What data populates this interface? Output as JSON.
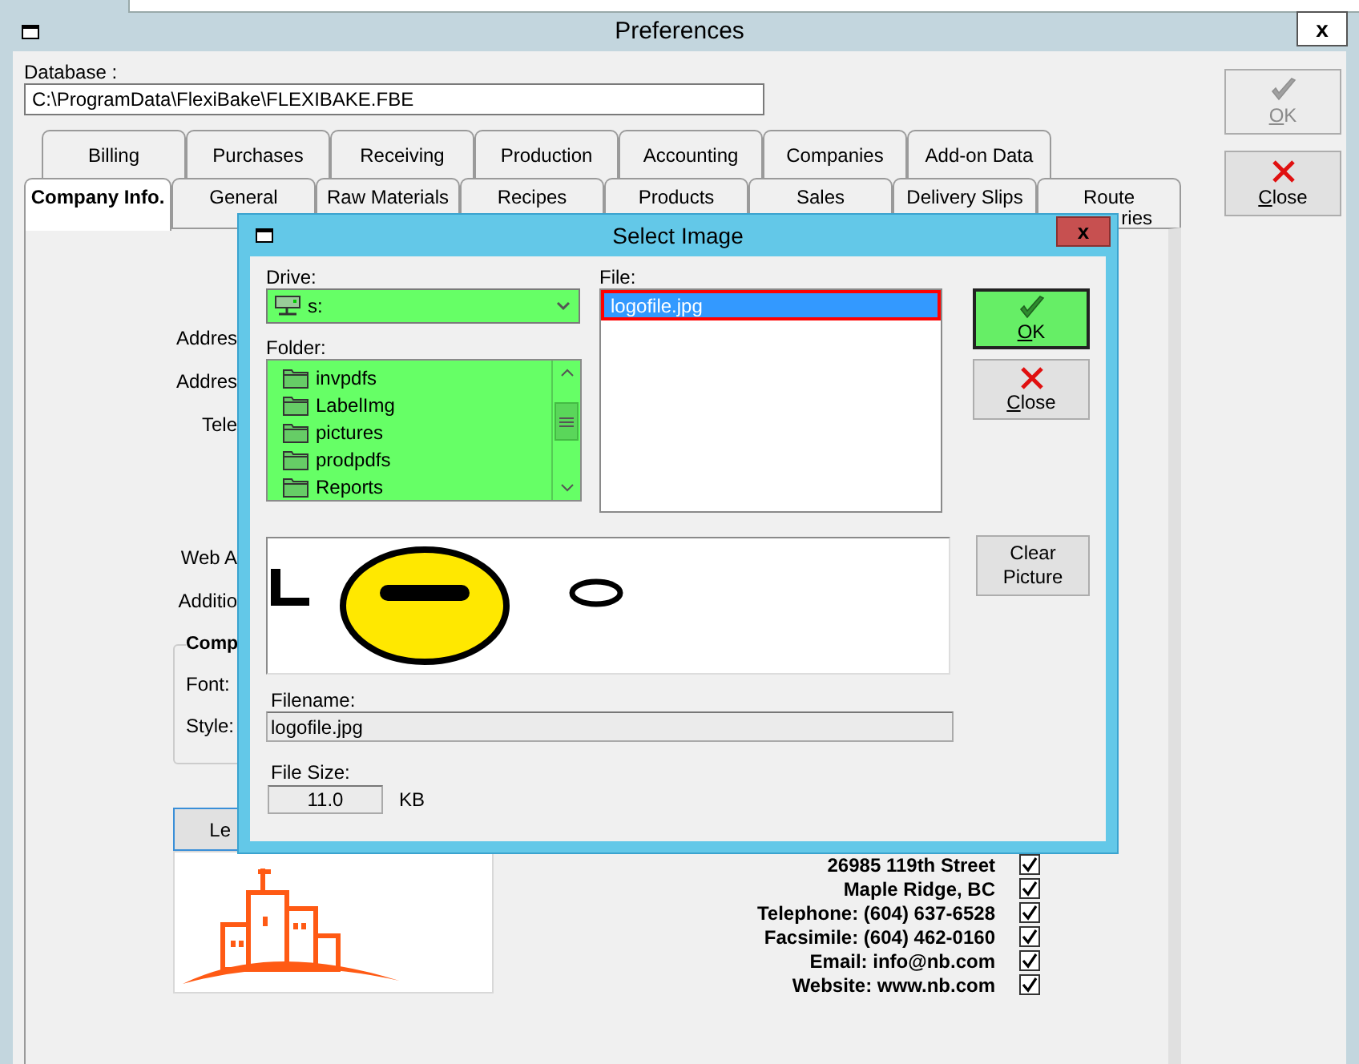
{
  "window": {
    "title": "Preferences",
    "close": "x"
  },
  "database": {
    "label": "Database :",
    "value": "C:\\ProgramData\\FlexiBake\\FLEXIBAKE.FBE"
  },
  "buttons": [
    {
      "label": "OK",
      "disabled": true,
      "kind": "ok"
    },
    {
      "label": "Close",
      "disabled": false,
      "kind": "close"
    }
  ],
  "tabs_row_1": [
    {
      "label": "Billing",
      "selected": false
    },
    {
      "label": "Purchases",
      "selected": false
    },
    {
      "label": "Receiving",
      "selected": false
    },
    {
      "label": "Production",
      "selected": false
    },
    {
      "label": "Accounting",
      "selected": false
    },
    {
      "label": "Companies",
      "selected": false
    },
    {
      "label": "Add-on Data",
      "selected": false
    }
  ],
  "tabs_row_2": [
    {
      "label": "Company Info.",
      "selected": true
    },
    {
      "label": "General",
      "selected": false
    },
    {
      "label": "Raw Materials",
      "selected": false
    },
    {
      "label": "Recipes",
      "selected": false
    },
    {
      "label": "Products",
      "selected": false
    },
    {
      "label": "Sales",
      "selected": false
    },
    {
      "label": "Delivery Slips",
      "selected": false
    },
    {
      "label": "Route",
      "label_2": "ries",
      "selected": false
    }
  ],
  "company_info": {
    "labels": [
      "Addres",
      "Addres",
      "Tele",
      "Web A",
      "Additio"
    ],
    "group": {
      "title": "Comp",
      "labels": [
        "Font:",
        "Style:"
      ]
    },
    "logo_button": {
      "label": "Le",
      "focused": true
    },
    "logo": {
      "kind": "picture"
    },
    "header_lines": [
      {
        "text": "26985 119th Street",
        "checked": true
      },
      {
        "text": "Maple Ridge, BC",
        "checked": true
      },
      {
        "text": "Telephone: (604) 637-6528",
        "checked": true
      },
      {
        "text": "Facsimile: (604) 462-0160",
        "checked": true
      },
      {
        "text": "Email: info@nb.com",
        "checked": true
      },
      {
        "text": "Website: www.nb.com",
        "checked": true
      }
    ]
  },
  "dialog": {
    "title": "Select Image",
    "close": "x",
    "drive": {
      "label": "Drive:",
      "value": "s:"
    },
    "folder": {
      "label": "Folder:",
      "items": [
        "invpdfs",
        "LabelImg",
        "pictures",
        "prodpdfs",
        "Reports"
      ]
    },
    "file": {
      "label": "File:",
      "items": [
        {
          "name": "logofile.jpg",
          "selected": true
        }
      ]
    },
    "buttons": [
      {
        "label": "OK",
        "focused": true,
        "kind": "ok"
      },
      {
        "label": "Close",
        "focused": false,
        "kind": "close"
      }
    ],
    "preview": {
      "kind": "picture"
    },
    "clear_button": "Clear Picture",
    "filename": {
      "label": "Filename:",
      "value": "logofile.jpg"
    },
    "file_size": {
      "label": "File Size:",
      "value": "11.0",
      "unit": "KB"
    }
  }
}
